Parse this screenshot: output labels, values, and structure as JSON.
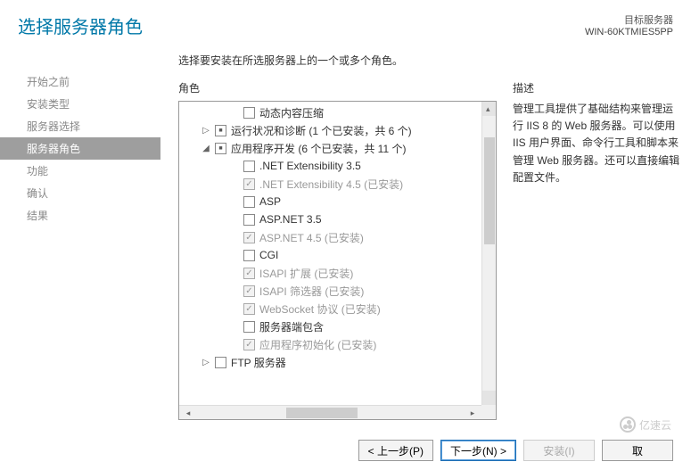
{
  "header": {
    "title": "选择服务器角色",
    "target_label": "目标服务器",
    "target_server": "WIN-60KTMIES5PP"
  },
  "nav": {
    "items": [
      {
        "label": "开始之前",
        "state": "done"
      },
      {
        "label": "安装类型",
        "state": "done"
      },
      {
        "label": "服务器选择",
        "state": "done"
      },
      {
        "label": "服务器角色",
        "state": "active"
      },
      {
        "label": "功能",
        "state": "pending"
      },
      {
        "label": "确认",
        "state": "pending"
      },
      {
        "label": "结果",
        "state": "pending"
      }
    ]
  },
  "main": {
    "instruction": "选择要安装在所选服务器上的一个或多个角色。",
    "roles_heading": "角色",
    "desc_heading": "描述",
    "description": "管理工具提供了基础结构来管理运行 IIS 8 的 Web 服务器。可以使用 IIS 用户界面、命令行工具和脚本来管理 Web 服务器。还可以直接编辑配置文件。"
  },
  "tree": [
    {
      "indent": 2,
      "expander": "",
      "check": "empty",
      "label": "动态内容压缩",
      "dim": false
    },
    {
      "indent": 1,
      "expander": "collapsed",
      "check": "mixed",
      "label": "运行状况和诊断 (1 个已安装，共 6 个)",
      "dim": false
    },
    {
      "indent": 1,
      "expander": "expanded",
      "check": "mixed",
      "label": "应用程序开发 (6 个已安装，共 11 个)",
      "dim": false
    },
    {
      "indent": 2,
      "expander": "",
      "check": "empty",
      "label": ".NET Extensibility 3.5",
      "dim": false
    },
    {
      "indent": 2,
      "expander": "",
      "check": "installed",
      "label": ".NET Extensibility 4.5 (已安装)",
      "dim": true
    },
    {
      "indent": 2,
      "expander": "",
      "check": "empty",
      "label": "ASP",
      "dim": false
    },
    {
      "indent": 2,
      "expander": "",
      "check": "empty",
      "label": "ASP.NET 3.5",
      "dim": false
    },
    {
      "indent": 2,
      "expander": "",
      "check": "installed",
      "label": "ASP.NET 4.5 (已安装)",
      "dim": true
    },
    {
      "indent": 2,
      "expander": "",
      "check": "empty",
      "label": "CGI",
      "dim": false
    },
    {
      "indent": 2,
      "expander": "",
      "check": "installed",
      "label": "ISAPI 扩展 (已安装)",
      "dim": true
    },
    {
      "indent": 2,
      "expander": "",
      "check": "installed",
      "label": "ISAPI 筛选器 (已安装)",
      "dim": true
    },
    {
      "indent": 2,
      "expander": "",
      "check": "installed",
      "label": "WebSocket 协议 (已安装)",
      "dim": true
    },
    {
      "indent": 2,
      "expander": "",
      "check": "empty",
      "label": "服务器端包含",
      "dim": false
    },
    {
      "indent": 2,
      "expander": "",
      "check": "installed",
      "label": "应用程序初始化 (已安装)",
      "dim": true
    },
    {
      "indent": 1,
      "expander": "collapsed",
      "check": "empty",
      "label": "FTP 服务器",
      "dim": false
    }
  ],
  "footer": {
    "prev": "< 上一步(P)",
    "next": "下一步(N) >",
    "install": "安装(I)",
    "cancel": "取"
  },
  "watermark": "亿速云"
}
